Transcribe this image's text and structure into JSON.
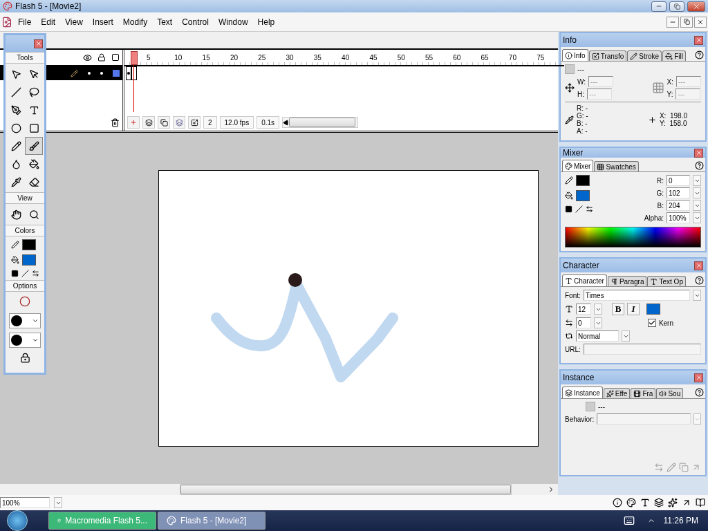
{
  "window": {
    "title": "Flash 5 - [Movie2]"
  },
  "menu": [
    "File",
    "Edit",
    "View",
    "Insert",
    "Modify",
    "Text",
    "Control",
    "Window",
    "Help"
  ],
  "tools_panel": {
    "title": "Tools",
    "tools": [
      {
        "kind": "arrow",
        "selected": false
      },
      {
        "kind": "subselect",
        "selected": false
      },
      {
        "kind": "line",
        "selected": false
      },
      {
        "kind": "lasso",
        "selected": false
      },
      {
        "kind": "pen",
        "selected": false
      },
      {
        "kind": "text",
        "selected": false
      },
      {
        "kind": "oval",
        "selected": false
      },
      {
        "kind": "rectangle",
        "selected": false
      },
      {
        "kind": "pencil",
        "selected": false
      },
      {
        "kind": "brush",
        "selected": true
      },
      {
        "kind": "ink",
        "selected": false
      },
      {
        "kind": "bucket",
        "selected": false
      },
      {
        "kind": "dropper",
        "selected": false
      },
      {
        "kind": "eraser",
        "selected": false
      }
    ],
    "view_label": "View",
    "view_tools": [
      {
        "kind": "hand",
        "selected": false
      },
      {
        "kind": "zoom",
        "selected": false
      }
    ],
    "colors_label": "Colors",
    "colors": [
      {
        "kind": "stroke",
        "color": "#000000"
      },
      {
        "kind": "fill",
        "color": "#0066cc"
      }
    ],
    "options_label": "Options"
  },
  "timeline": {
    "frame_numbers": [
      "5",
      "10",
      "15",
      "20",
      "25",
      "30",
      "35",
      "40",
      "45",
      "50",
      "55",
      "60",
      "65",
      "70",
      "75"
    ],
    "layers": [
      {
        "selected": true
      }
    ],
    "current_frame": "2",
    "frame_rate": "12.0 fps",
    "elapsed_time": "0.1s"
  },
  "info_panel": {
    "title": "Info",
    "tabs": [
      {
        "label": "Info",
        "selected": true
      },
      {
        "label": "Transfo",
        "selected": false
      },
      {
        "label": "Stroke",
        "selected": false
      },
      {
        "label": "Fill",
        "selected": false
      }
    ],
    "swatch_value": "---",
    "size_fields": [
      {
        "label": "W:",
        "placeholder": "---"
      },
      {
        "label": "H:",
        "placeholder": "---"
      }
    ],
    "position_fields": [
      {
        "label": "X:",
        "placeholder": "---"
      },
      {
        "label": "Y:",
        "placeholder": "---"
      }
    ],
    "color_readout": [
      {
        "label": "R:",
        "value": "-"
      },
      {
        "label": "G:",
        "value": "-"
      },
      {
        "label": "B:",
        "value": "-"
      },
      {
        "label": "A:",
        "value": "-"
      }
    ],
    "cursor": [
      {
        "label": "X:",
        "value": "198.0"
      },
      {
        "label": "Y:",
        "value": "158.0"
      }
    ]
  },
  "mixer_panel": {
    "title": "Mixer",
    "tabs": [
      {
        "label": "Mixer",
        "selected": true
      },
      {
        "label": "Swatches",
        "selected": false
      }
    ],
    "colors": [
      {
        "kind": "stroke",
        "color": "#000000"
      },
      {
        "kind": "fill",
        "color": "#0066cc"
      }
    ],
    "channels": [
      {
        "label": "R:",
        "value": "0"
      },
      {
        "label": "G:",
        "value": "102"
      },
      {
        "label": "B:",
        "value": "204"
      },
      {
        "label": "Alpha:",
        "value": "100%"
      }
    ]
  },
  "character_panel": {
    "title": "Character",
    "tabs": [
      {
        "label": "Character",
        "selected": true
      },
      {
        "label": "Paragra",
        "selected": false
      },
      {
        "label": "Text Op",
        "selected": false
      }
    ],
    "font_label": "Font:",
    "font": "Times",
    "size": "12",
    "bold_button": "B",
    "italic_button": "I",
    "text_colors": [
      {
        "color": "#0066cc"
      }
    ],
    "tracking": "0",
    "kern": {
      "label": "Kern",
      "checked": true
    },
    "baseline": "Normal",
    "url_label": "URL:"
  },
  "instance_panel": {
    "title": "Instance",
    "tabs": [
      {
        "label": "Instance",
        "selected": true
      },
      {
        "label": "Effe",
        "selected": false
      },
      {
        "label": "Fra",
        "selected": false
      },
      {
        "label": "Sou",
        "selected": false
      }
    ],
    "swatch_value": "---",
    "behavior_label": "Behavior:"
  },
  "status_bar": {
    "zoom": "100%"
  },
  "taskbar": {
    "tasks": [
      {
        "label": "Macromedia Flash 5...",
        "color": "#3cb878"
      },
      {
        "label": "Flash 5 - [Movie2]",
        "color": "#8091b6"
      }
    ],
    "clock": "11:26 PM"
  }
}
